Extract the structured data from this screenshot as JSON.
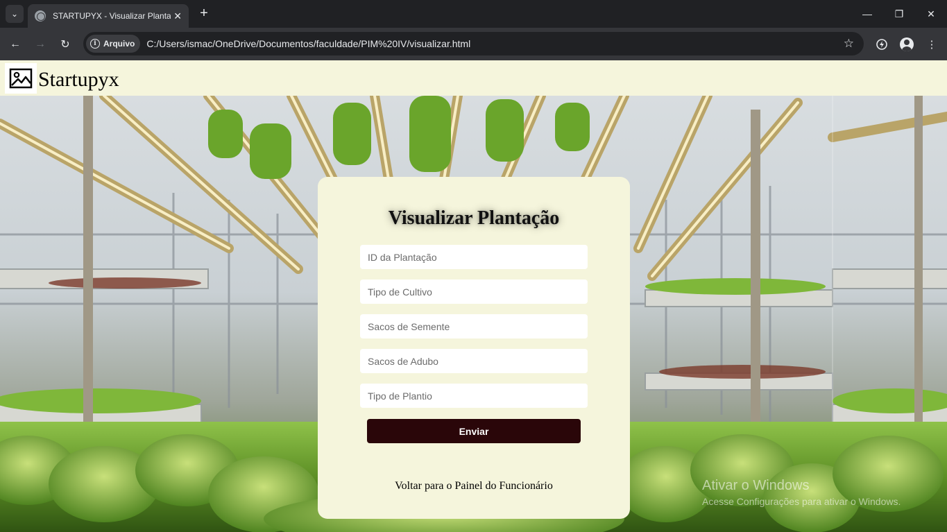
{
  "browser": {
    "tab_title": "STARTUPYX - Visualizar Plantação",
    "tab_close": "✕",
    "new_tab": "+",
    "window_controls": {
      "minimize": "—",
      "restore": "❐",
      "close": "✕"
    },
    "nav": {
      "back": "←",
      "forward": "→",
      "reload": "↻"
    },
    "security_chip_label": "Arquivo",
    "url": "C:/Users/ismac/OneDrive/Documentos/faculdade/PIM%20IV/visualizar.html",
    "icons": [
      "tab-search-icon",
      "globe-icon",
      "info-icon",
      "star-icon",
      "extension-icon",
      "profile-icon",
      "more-icon"
    ]
  },
  "header": {
    "brand": "Startupyx",
    "logo_icon": "image-icon"
  },
  "form": {
    "title": "Visualizar Plantação",
    "fields": {
      "id": {
        "placeholder": "ID da Plantação",
        "value": ""
      },
      "cultivo": {
        "placeholder": "Tipo de Cultivo",
        "value": ""
      },
      "semente": {
        "placeholder": "Sacos de Semente",
        "value": ""
      },
      "adubo": {
        "placeholder": "Sacos de Adubo",
        "value": ""
      },
      "plantio": {
        "placeholder": "Tipo de Plantio",
        "value": ""
      }
    },
    "submit_label": "Enviar",
    "back_link": "Voltar para o Painel do Funcionário"
  },
  "watermark": {
    "title": "Ativar o Windows",
    "subtitle": "Acesse Configurações para ativar o Windows."
  },
  "colors": {
    "header_bg": "#f5f5dc",
    "card_bg": "#f5f5dc",
    "button_bg": "#2a0609",
    "chrome_dark": "#202124",
    "chrome_toolbar": "#35363a"
  }
}
